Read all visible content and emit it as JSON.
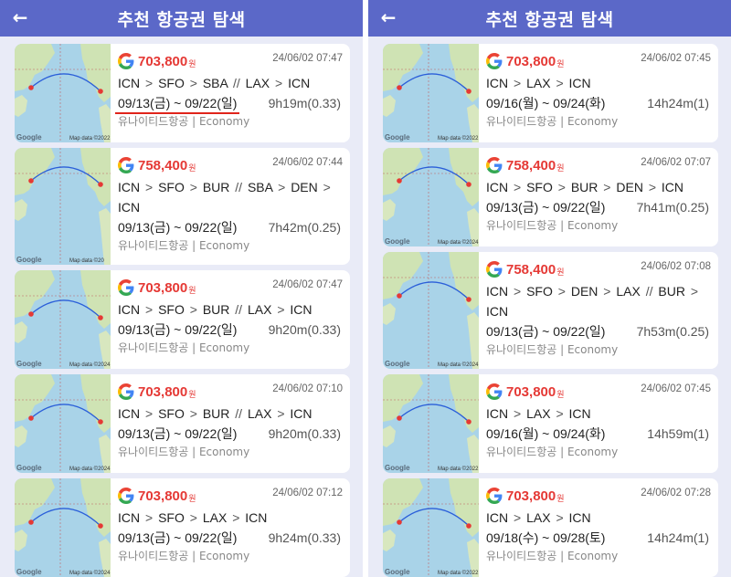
{
  "header": {
    "title": "추천 항공권 탐색",
    "back_icon": "arrow-left-icon"
  },
  "currency_suffix": "원",
  "map_labels": {
    "google": "Google"
  },
  "left": {
    "cards": [
      {
        "price": "703,800",
        "timestamp": "24/06/02 07:47",
        "route": [
          "ICN",
          ">",
          "SFO",
          ">",
          "SBA",
          "//",
          "LAX",
          ">",
          "ICN"
        ],
        "dates": "09/13(금) ~ 09/22(일)",
        "duration": "9h19m(0.33)",
        "airline": "유나이티드항공 | Economy",
        "map_data": "Map data ©2022",
        "underlined": true
      },
      {
        "price": "758,400",
        "timestamp": "24/06/02 07:44",
        "route": [
          "ICN",
          ">",
          "SFO",
          ">",
          "BUR",
          "//",
          "SBA",
          ">",
          "DEN",
          ">",
          "ICN"
        ],
        "dates": "09/13(금) ~ 09/22(일)",
        "duration": "7h42m(0.25)",
        "airline": "유나이티드항공 | Economy",
        "map_data": "Map data ©20",
        "underlined": false
      },
      {
        "price": "703,800",
        "timestamp": "24/06/02 07:47",
        "route": [
          "ICN",
          ">",
          "SFO",
          ">",
          "BUR",
          "//",
          "LAX",
          ">",
          "ICN"
        ],
        "dates": "09/13(금) ~ 09/22(일)",
        "duration": "9h20m(0.33)",
        "airline": "유나이티드항공 | Economy",
        "map_data": "Map data ©2024",
        "underlined": false
      },
      {
        "price": "703,800",
        "timestamp": "24/06/02 07:10",
        "route": [
          "ICN",
          ">",
          "SFO",
          ">",
          "BUR",
          "//",
          "LAX",
          ">",
          "ICN"
        ],
        "dates": "09/13(금) ~ 09/22(일)",
        "duration": "9h20m(0.33)",
        "airline": "유나이티드항공 | Economy",
        "map_data": "Map data ©2024",
        "underlined": false
      },
      {
        "price": "703,800",
        "timestamp": "24/06/02 07:12",
        "route": [
          "ICN",
          ">",
          "SFO",
          ">",
          "LAX",
          ">",
          "ICN"
        ],
        "dates": "09/13(금) ~ 09/22(일)",
        "duration": "9h24m(0.33)",
        "airline": "유나이티드항공 | Economy",
        "map_data": "Map data ©2024",
        "underlined": false
      }
    ]
  },
  "right": {
    "cards": [
      {
        "price": "703,800",
        "timestamp": "24/06/02 07:45",
        "route": [
          "ICN",
          ">",
          "LAX",
          ">",
          "ICN"
        ],
        "dates": "09/16(월) ~ 09/24(화)",
        "duration": "14h24m(1)",
        "airline": "유나이티드항공 | Economy",
        "map_data": "Map data ©2022",
        "underlined": false
      },
      {
        "price": "758,400",
        "timestamp": "24/06/02 07:07",
        "route": [
          "ICN",
          ">",
          "SFO",
          ">",
          "BUR",
          ">",
          "DEN",
          ">",
          "ICN"
        ],
        "dates": "09/13(금) ~ 09/22(일)",
        "duration": "7h41m(0.25)",
        "airline": "유나이티드항공 | Economy",
        "map_data": "Map data ©2024",
        "underlined": false
      },
      {
        "price": "758,400",
        "timestamp": "24/06/02 07:08",
        "route": [
          "ICN",
          ">",
          "SFO",
          ">",
          "DEN",
          ">",
          "LAX",
          "//",
          "BUR",
          ">",
          "ICN"
        ],
        "dates": "09/13(금) ~ 09/22(일)",
        "duration": "7h53m(0.25)",
        "airline": "유나이티드항공 | Economy",
        "map_data": "Map data ©2024",
        "underlined": false
      },
      {
        "price": "703,800",
        "timestamp": "24/06/02 07:45",
        "route": [
          "ICN",
          ">",
          "LAX",
          ">",
          "ICN"
        ],
        "dates": "09/16(월) ~ 09/24(화)",
        "duration": "14h59m(1)",
        "airline": "유나이티드항공 | Economy",
        "map_data": "Map data ©2022",
        "underlined": false
      },
      {
        "price": "703,800",
        "timestamp": "24/06/02 07:28",
        "route": [
          "ICN",
          ">",
          "LAX",
          ">",
          "ICN"
        ],
        "dates": "09/18(수) ~ 09/28(토)",
        "duration": "14h24m(1)",
        "airline": "유나이티드항공 | Economy",
        "map_data": "Map data ©2022",
        "underlined": false
      }
    ]
  },
  "colors": {
    "header": "#5b68c8",
    "price": "#e53935",
    "background": "#e9ebf7",
    "route_line": "#2b5fd9",
    "pin": "#e53935"
  }
}
